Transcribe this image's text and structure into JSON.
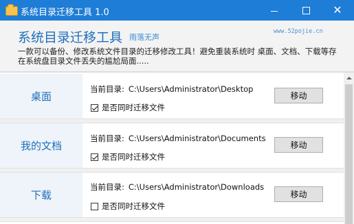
{
  "window": {
    "title": "系统目录迁移工具 1.0",
    "min_glyph": "",
    "max_glyph": "",
    "close_glyph": "✕"
  },
  "header": {
    "app_title": "系统目录迁移工具",
    "subtitle": "雨落无声",
    "website": "www.52pojie.cn",
    "description": "一款可以备份、修改系统文件目录的迁移修改工具！避免重装系统时 桌面、文档、下载等存在系统盘目录文件丢失的尴尬局面....."
  },
  "sections": [
    {
      "label": "桌面",
      "path_label": "当前目录:",
      "path": "C:\\Users\\Administrator\\Desktop",
      "checkbox_label": "是否同时迁移文件",
      "checked": true,
      "button": "移动"
    },
    {
      "label": "我的文档",
      "path_label": "当前目录:",
      "path": "C:\\Users\\Administrator\\Documents",
      "checkbox_label": "是否同时迁移文件",
      "checked": true,
      "button": "移动"
    },
    {
      "label": "下载",
      "path_label": "当前目录:",
      "path": "C:\\Users\\Administrator\\Downloads",
      "checkbox_label": "是否同时迁移文件",
      "checked": false,
      "button": "移动"
    }
  ],
  "colors": {
    "titlebar": "#1e7dd6",
    "accent": "#1f6fbd"
  }
}
